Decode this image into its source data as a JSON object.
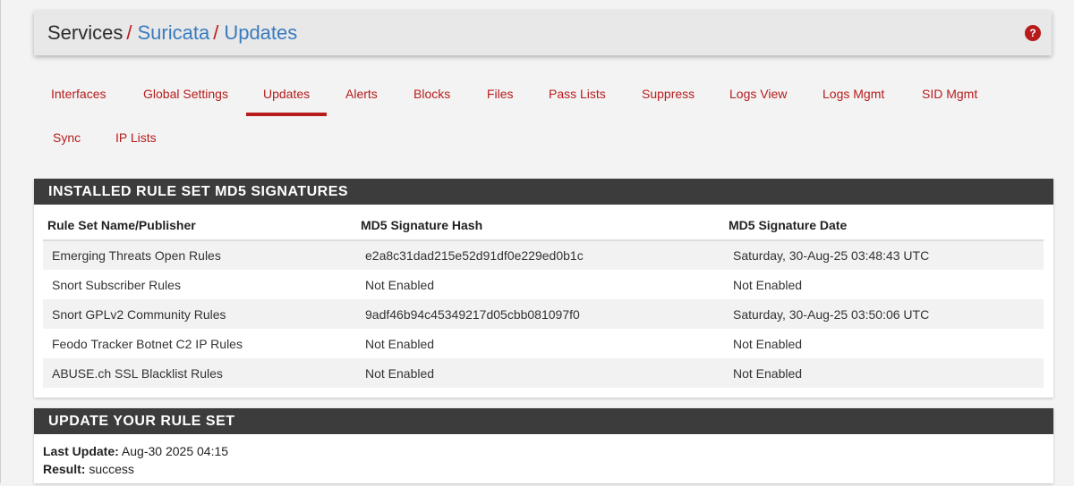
{
  "breadcrumb": {
    "root": "Services",
    "sep": "/",
    "items": [
      "Suricata",
      "Updates"
    ]
  },
  "help_icon": "?",
  "tabs": [
    {
      "label": "Interfaces"
    },
    {
      "label": "Global Settings"
    },
    {
      "label": "Updates",
      "active": true
    },
    {
      "label": "Alerts"
    },
    {
      "label": "Blocks"
    },
    {
      "label": "Files"
    },
    {
      "label": "Pass Lists"
    },
    {
      "label": "Suppress"
    },
    {
      "label": "Logs View"
    },
    {
      "label": "Logs Mgmt"
    },
    {
      "label": "SID Mgmt"
    },
    {
      "label": "Sync"
    },
    {
      "label": "IP Lists"
    }
  ],
  "md5_panel": {
    "title": "INSTALLED RULE SET MD5 SIGNATURES",
    "headers": [
      "Rule Set Name/Publisher",
      "MD5 Signature Hash",
      "MD5 Signature Date"
    ],
    "rows": [
      [
        "Emerging Threats Open Rules",
        "e2a8c31dad215e52d91df0e229ed0b1c",
        "Saturday, 30-Aug-25 03:48:43 UTC"
      ],
      [
        "Snort Subscriber Rules",
        "Not Enabled",
        "Not Enabled"
      ],
      [
        "Snort GPLv2 Community Rules",
        "9adf46b94c45349217d05cbb081097f0",
        "Saturday, 30-Aug-25 03:50:06 UTC"
      ],
      [
        "Feodo Tracker Botnet C2 IP Rules",
        "Not Enabled",
        "Not Enabled"
      ],
      [
        "ABUSE.ch SSL Blacklist Rules",
        "Not Enabled",
        "Not Enabled"
      ]
    ]
  },
  "update_panel": {
    "title": "UPDATE YOUR RULE SET",
    "last_update_label": "Last Update:",
    "last_update_value": "Aug-30 2025 04:15",
    "result_label": "Result:",
    "result_value": "success"
  },
  "colors": {
    "accent": "#b71c1c",
    "link": "#3a7bbf",
    "panel_heading": "#3c3c3c"
  }
}
